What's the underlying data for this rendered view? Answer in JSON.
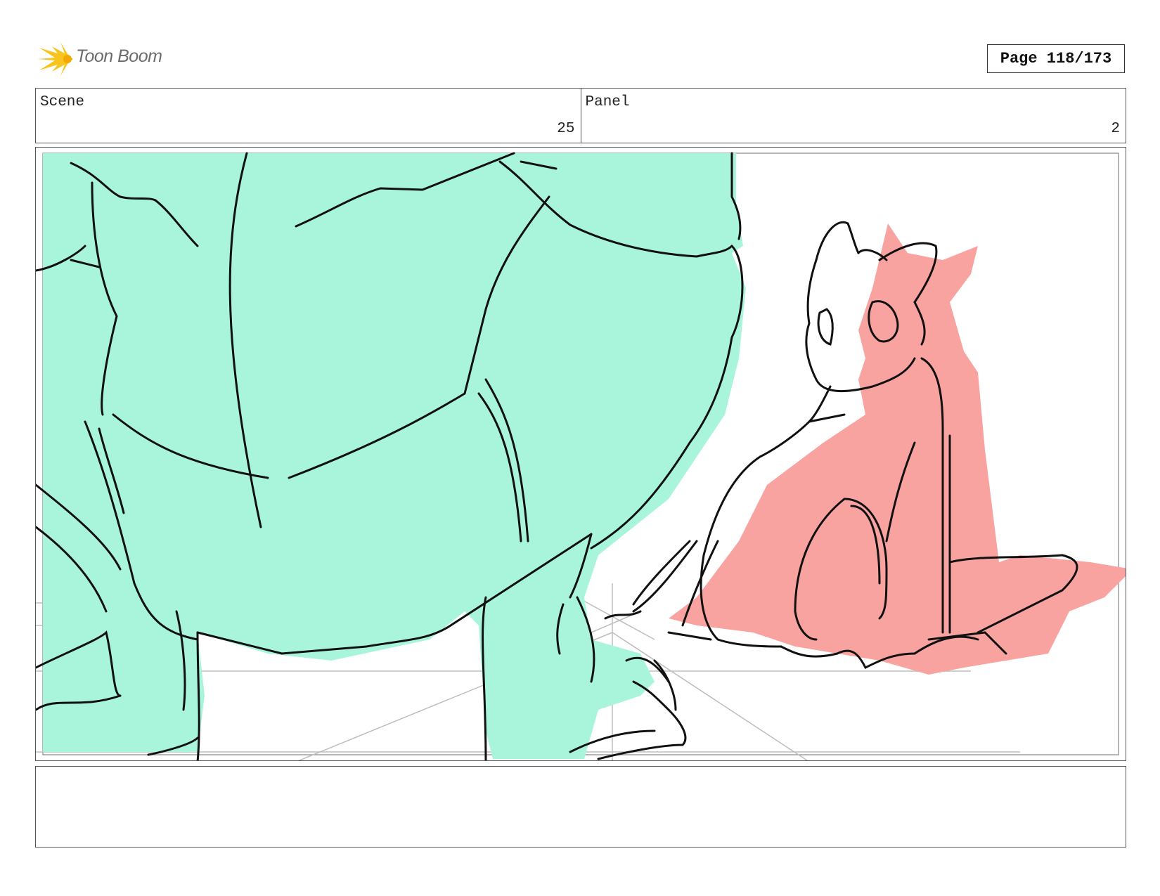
{
  "header": {
    "logo_text": "Toon Boom",
    "page_indicator": "Page 118/173"
  },
  "scene": {
    "label": "Scene",
    "value": "25"
  },
  "panel": {
    "label": "Panel",
    "value": "2"
  },
  "colors": {
    "character_left": "#a8f5dc",
    "character_right": "#f9a3a1",
    "logo_accent": "#f7c51e",
    "line": "#111111",
    "guide_lines": "#bdbdbd"
  },
  "notes": {
    "text": ""
  }
}
